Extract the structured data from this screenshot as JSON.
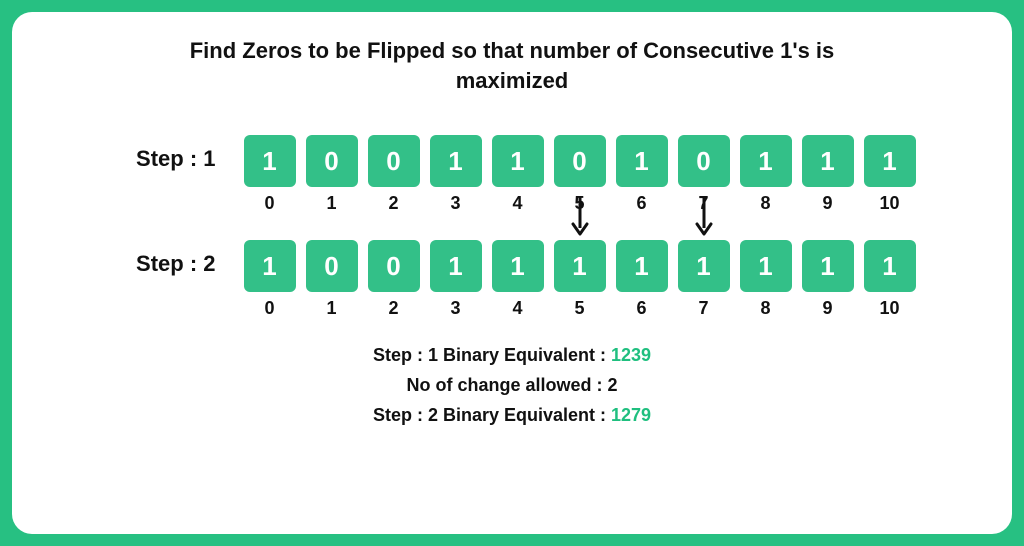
{
  "title": "Find Zeros to be Flipped so that number of Consecutive 1's is maximized",
  "step1": {
    "label": "Step : 1",
    "cells": [
      "1",
      "0",
      "0",
      "1",
      "1",
      "0",
      "1",
      "0",
      "1",
      "1",
      "1"
    ],
    "indices": [
      "0",
      "1",
      "2",
      "3",
      "4",
      "5",
      "6",
      "7",
      "8",
      "9",
      "10"
    ]
  },
  "step2": {
    "label": "Step : 2",
    "cells": [
      "1",
      "0",
      "0",
      "1",
      "1",
      "1",
      "1",
      "1",
      "1",
      "1",
      "1"
    ],
    "indices": [
      "0",
      "1",
      "2",
      "3",
      "4",
      "5",
      "6",
      "7",
      "8",
      "9",
      "10"
    ],
    "arrows_at": [
      5,
      7
    ]
  },
  "footer": {
    "line1_prefix": "Step : 1 Binary Equivalent : ",
    "line1_value": "1239",
    "line2": "No of change allowed : 2",
    "line3_prefix": "Step : 2 Binary Equivalent : ",
    "line3_value": "1279"
  },
  "chart_data": {
    "type": "table",
    "description": "Two binary arrays of length 11 showing before/after flipping zeros at indices 5 and 7 to maximize consecutive 1s",
    "arrays": [
      {
        "step": 1,
        "bits": [
          1,
          0,
          0,
          1,
          1,
          0,
          1,
          0,
          1,
          1,
          1
        ],
        "decimal_equivalent": 1239
      },
      {
        "step": 2,
        "bits": [
          1,
          0,
          0,
          1,
          1,
          1,
          1,
          1,
          1,
          1,
          1
        ],
        "decimal_equivalent": 1279
      }
    ],
    "flipped_indices": [
      5,
      7
    ],
    "changes_allowed": 2
  }
}
